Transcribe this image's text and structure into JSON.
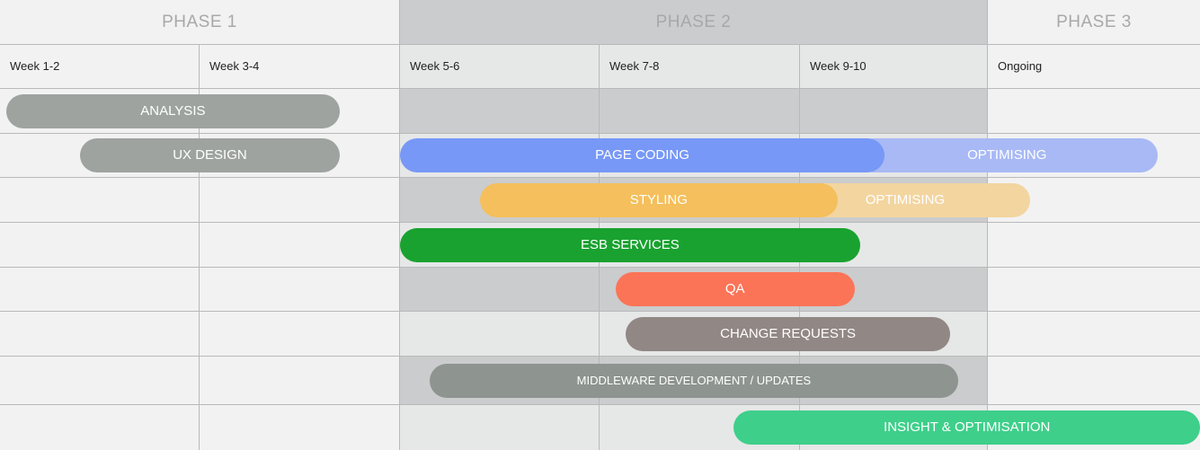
{
  "chart_data": {
    "type": "gantt",
    "phases": [
      {
        "name": "PHASE 1",
        "start": 0,
        "end": 2
      },
      {
        "name": "PHASE 2",
        "start": 2,
        "end": 5
      },
      {
        "name": "PHASE 3",
        "start": 5,
        "end": 6
      }
    ],
    "columns": [
      "Week 1-2",
      "Week 3-4",
      "Week 5-6",
      "Week 7-8",
      "Week 9-10",
      "Ongoing"
    ],
    "tasks": [
      {
        "label": "ANALYSIS",
        "row": 0,
        "start": 0.03,
        "end": 1.7,
        "color": "#9ea3a0"
      },
      {
        "label": "UX DESIGN",
        "row": 1,
        "start": 0.4,
        "end": 1.7,
        "color": "#9ea3a0"
      },
      {
        "label": "OPTIMISING",
        "row": 1,
        "start": 4.3,
        "end": 5.8,
        "color": "#a8b9f5"
      },
      {
        "label": "PAGE CODING",
        "row": 1,
        "start": 2.0,
        "end": 4.45,
        "color": "#7798f6"
      },
      {
        "label": "OPTIMISING",
        "row": 2,
        "start": 3.9,
        "end": 5.2,
        "color": "#f3d5a0"
      },
      {
        "label": "STYLING",
        "row": 2,
        "start": 2.4,
        "end": 4.2,
        "color": "#f4bf5c"
      },
      {
        "label": "ESB SERVICES",
        "row": 3,
        "start": 2.0,
        "end": 4.32,
        "color": "#19a22f"
      },
      {
        "label": "QA",
        "row": 4,
        "start": 3.08,
        "end": 4.29,
        "color": "#fb7457"
      },
      {
        "label": "CHANGE REQUESTS",
        "row": 5,
        "start": 3.13,
        "end": 4.8,
        "color": "#918784"
      },
      {
        "label": "MIDDLEWARE DEVELOPMENT / UPDATES",
        "row": 6,
        "start": 2.15,
        "end": 4.84,
        "color": "#8e948f"
      },
      {
        "label": "INSIGHT & OPTIMISATION",
        "row": 7,
        "start": 3.67,
        "end": 6.0,
        "color": "#3ecf8a"
      }
    ]
  }
}
